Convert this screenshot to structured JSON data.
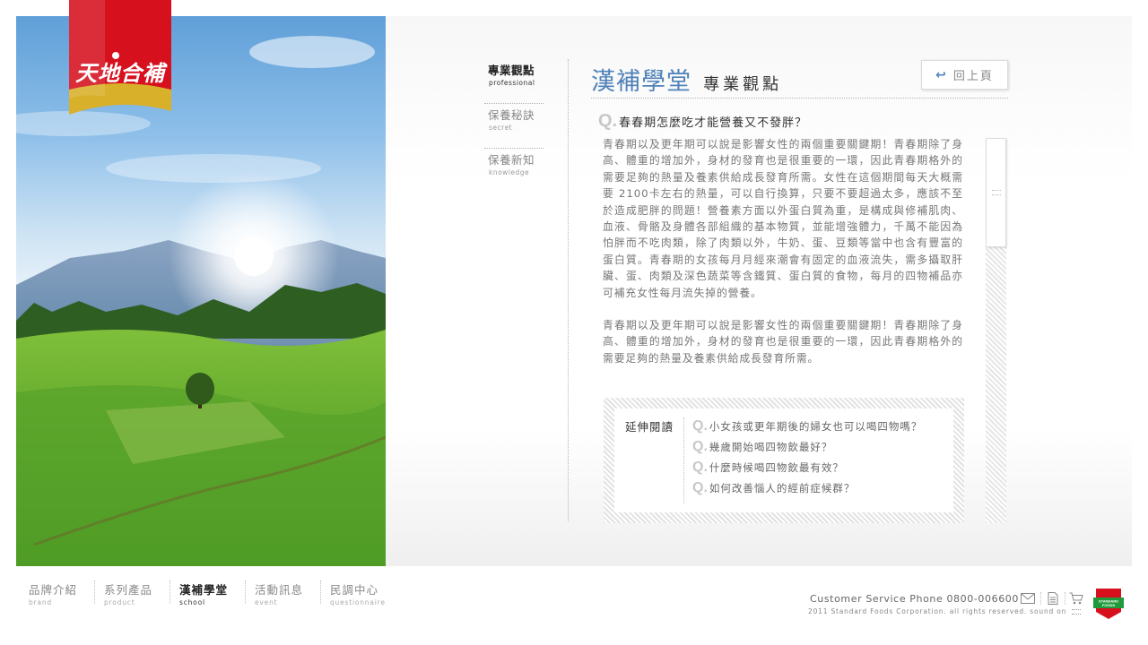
{
  "brand": {
    "logo_text": "天地合補",
    "colors": {
      "red": "#d7101e",
      "gold": "#d9b02a",
      "accent": "#4f82b8"
    }
  },
  "subnav": {
    "items": [
      {
        "zh": "專業觀點",
        "en": "professional",
        "active": true
      },
      {
        "zh": "保養秘訣",
        "en": "secret",
        "active": false
      },
      {
        "zh": "保養新知",
        "en": "knowledge",
        "active": false
      }
    ]
  },
  "section": {
    "title": "漢補學堂",
    "subtitle": "專業觀點"
  },
  "back_button": {
    "label": "回上頁",
    "icon": "return-arrow-icon"
  },
  "question": {
    "mark": "Q.",
    "text": "春春期怎麼吃才能營養又不發胖？"
  },
  "article": {
    "paragraphs": [
      "青春期以及更年期可以說是影響女性的兩個重要關鍵期！青春期除了身高、體重的增加外，身材的發育也是很重要的一環，因此青春期格外的需要足夠的熱量及養素供給成長發育所需。女性在這個期間每天大概需要 2100卡左右的熱量，可以自行換算，只要不要超過太多，應該不至於造成肥胖的問題！營養素方面以外蛋白質為重，是構成與修補肌肉、血液、骨骼及身體各部組織的基本物質，並能增強體力，千萬不能因為怕胖而不吃肉類，除了肉類以外，牛奶、蛋、豆類等當中也含有豐富的蛋白質。青春期的女孩每月月經來潮會有固定的血液流失，需多攝取肝臟、蛋、肉類及深色蔬菜等含鐵質、蛋白質的食物，每月的四物補品亦可補充女性每月流失掉的營養。",
      "青春期以及更年期可以說是影響女性的兩個重要關鍵期！青春期除了身高、體重的增加外，身材的發育也是很重要的一環，因此青春期格外的需要足夠的熱量及養素供給成長發育所需。"
    ]
  },
  "related": {
    "label": "延伸閱讀",
    "items": [
      "小女孩或更年期後的婦女也可以喝四物嗎？",
      "幾歲開始喝四物飲最好？",
      "什麼時候喝四物飲最有效？",
      "如何改善惱人的經前症候群？"
    ]
  },
  "footer_nav": [
    {
      "zh": "品牌介紹",
      "en": "brand",
      "active": false
    },
    {
      "zh": "系列產品",
      "en": "product",
      "active": false
    },
    {
      "zh": "漢補學堂",
      "en": "school",
      "active": true
    },
    {
      "zh": "活動訊息",
      "en": "event",
      "active": false
    },
    {
      "zh": "民調中心",
      "en": "questionnaire",
      "active": false
    }
  ],
  "footer": {
    "customer_service": "Customer Service Phone  0800-006600",
    "copyright": "2011 Standard Foods Corporation. all rights reserved. sound on",
    "icons": [
      "mail-icon",
      "document-icon",
      "cart-icon"
    ],
    "corp_logo_text": "STANDARD FOODS"
  }
}
